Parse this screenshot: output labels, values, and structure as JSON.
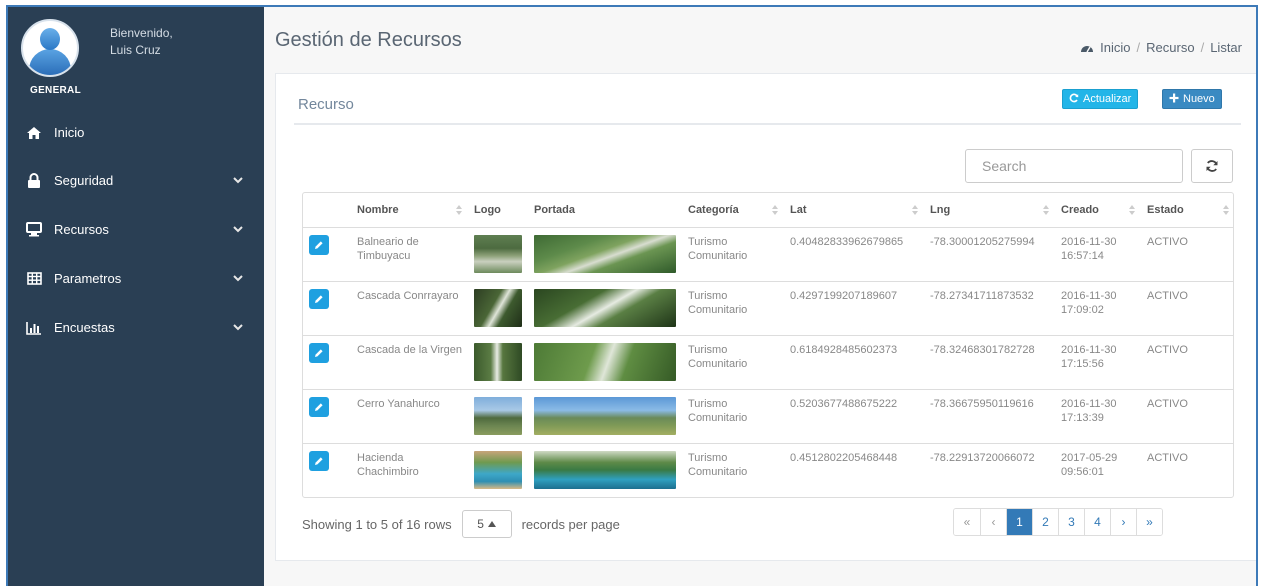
{
  "sidebar": {
    "welcome": "Bienvenido,",
    "user_name": "Luis Cruz",
    "role": "GENERAL",
    "items": [
      {
        "label": "Inicio",
        "icon": "home-icon"
      },
      {
        "label": "Seguridad",
        "icon": "lock-icon"
      },
      {
        "label": "Recursos",
        "icon": "monitor-icon"
      },
      {
        "label": "Parametros",
        "icon": "table-icon"
      },
      {
        "label": "Encuestas",
        "icon": "bar-chart-icon"
      }
    ]
  },
  "header": {
    "title": "Gestión de Recursos",
    "breadcrumb": [
      "Inicio",
      "Recurso",
      "Listar"
    ]
  },
  "panel": {
    "title": "Recurso",
    "refresh_label": "Actualizar",
    "new_label": "Nuevo"
  },
  "search": {
    "placeholder": "Search"
  },
  "table": {
    "columns": [
      "",
      "Nombre",
      "Logo",
      "Portada",
      "Categoría",
      "Lat",
      "Lng",
      "Creado",
      "Estado"
    ],
    "rows": [
      {
        "nombre": "Balneario de Timbuyacu",
        "categoria": "Turismo Comunitario",
        "lat": "0.40482833962679865",
        "lng": "-78.30001205275994",
        "creado": "2016-11-30 16:57:14",
        "estado": "ACTIVO"
      },
      {
        "nombre": "Cascada Conrrayaro",
        "categoria": "Turismo Comunitario",
        "lat": "0.4297199207189607",
        "lng": "-78.27341711873532",
        "creado": "2016-11-30 17:09:02",
        "estado": "ACTIVO"
      },
      {
        "nombre": "Cascada de la Virgen",
        "categoria": "Turismo Comunitario",
        "lat": "0.6184928485602373",
        "lng": "-78.32468301782728",
        "creado": "2016-11-30 17:15:56",
        "estado": "ACTIVO"
      },
      {
        "nombre": "Cerro Yanahurco",
        "categoria": "Turismo Comunitario",
        "lat": "0.5203677488675222",
        "lng": "-78.36675950119616",
        "creado": "2016-11-30 17:13:39",
        "estado": "ACTIVO"
      },
      {
        "nombre": "Hacienda Chachimbiro",
        "categoria": "Turismo Comunitario",
        "lat": "0.4512802205468448",
        "lng": "-78.22913720066072",
        "creado": "2017-05-29 09:56:01",
        "estado": "ACTIVO"
      }
    ]
  },
  "pager": {
    "showing": "Showing 1 to 5 of 16 rows",
    "page_size": "5",
    "records_label": "records per page",
    "first": "«",
    "prev": "‹",
    "pages": [
      "1",
      "2",
      "3",
      "4"
    ],
    "next": "›",
    "last": "»",
    "active_page": "1"
  },
  "colors": {
    "sidebar_bg": "#2a3f54",
    "accent": "#337ab7",
    "refresh_btn": "#23b5e8",
    "new_btn": "#3a8ac2",
    "edit_btn": "#1fa0e0"
  }
}
